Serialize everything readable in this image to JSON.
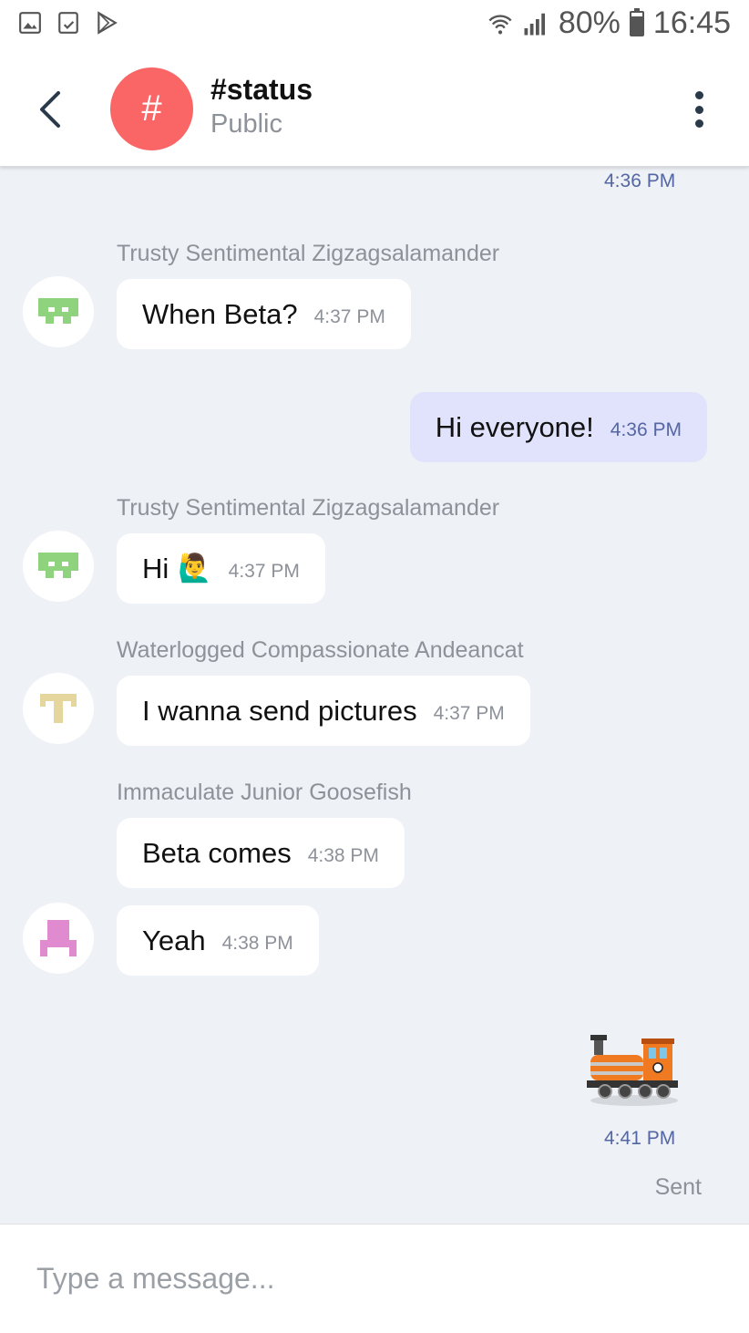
{
  "status_bar": {
    "icons_left": [
      "gallery-icon",
      "tablet-check-icon",
      "play-store-icon"
    ],
    "wifi": "wifi-icon",
    "signal": "signal-icon",
    "battery_percent": "80%",
    "time": "16:45"
  },
  "header": {
    "back_icon": "back-arrow-icon",
    "avatar_symbol": "#",
    "avatar_color": "#fa6566",
    "title": "#status",
    "subtitle": "Public",
    "menu_icon": "more-vert-icon"
  },
  "messages": {
    "top_time": "4:36 PM",
    "m1": {
      "sender": "Trusty Sentimental Zigzagsalamander",
      "text": "When Beta?",
      "time": "4:37 PM",
      "avatar_color": "#8fd37f"
    },
    "m2": {
      "text": "Hi everyone!",
      "time": "4:36 PM",
      "mine": true
    },
    "m3": {
      "sender": "Trusty Sentimental Zigzagsalamander",
      "text": "Hi",
      "emoji": "🙋‍♂️",
      "time": "4:37 PM",
      "avatar_color": "#8fd37f"
    },
    "m4": {
      "sender": "Waterlogged Compassionate Andeancat",
      "text": "I wanna send pictures",
      "time": "4:37 PM",
      "avatar_color": "#e5d69d"
    },
    "m5": {
      "sender": "Immaculate Junior Goosefish",
      "text": "Beta comes",
      "time": "4:38 PM"
    },
    "m6": {
      "text": "Yeah",
      "time": "4:38 PM",
      "avatar_color": "#e08ad0"
    },
    "m7": {
      "sticker": "locomotive-sticker",
      "time": "4:41 PM",
      "status": "Sent"
    }
  },
  "input": {
    "placeholder": "Type a message..."
  }
}
